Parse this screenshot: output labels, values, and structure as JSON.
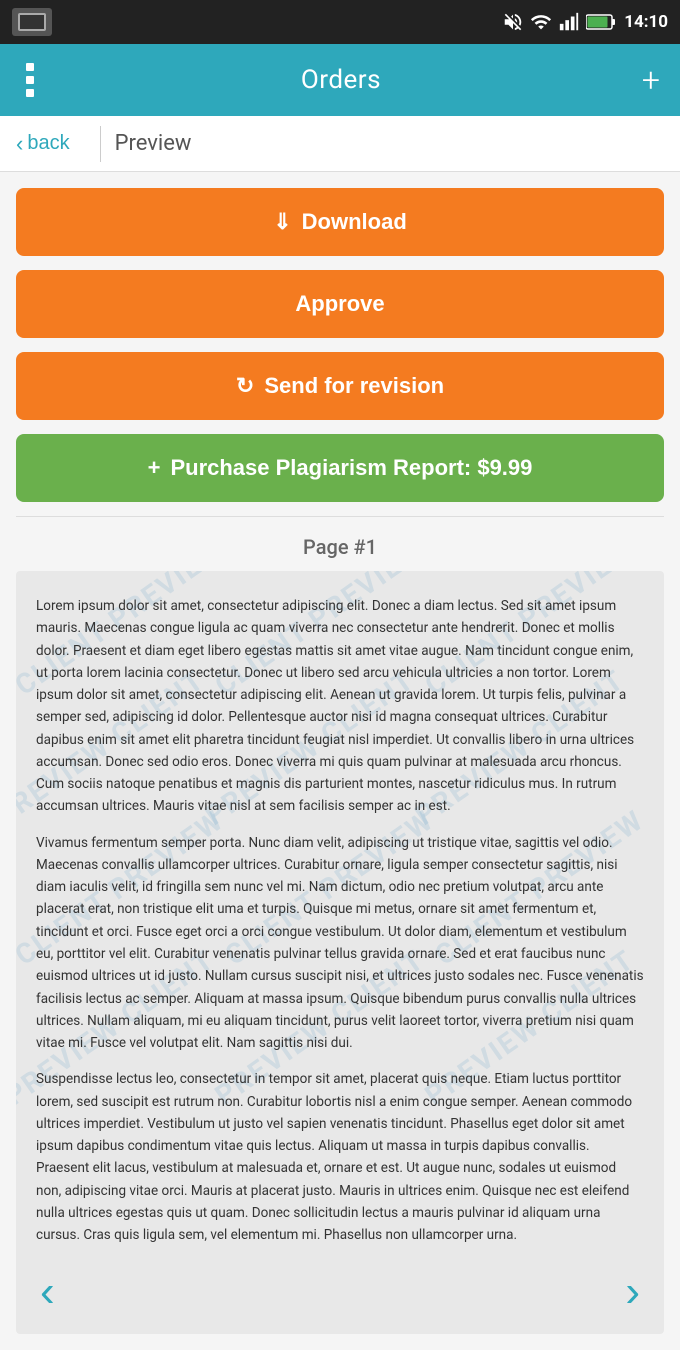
{
  "statusBar": {
    "time": "14:10"
  },
  "appBar": {
    "title": "Orders",
    "addIcon": "+"
  },
  "nav": {
    "backLabel": "back",
    "pageTitle": "Preview"
  },
  "buttons": {
    "download": "Download",
    "approve": "Approve",
    "sendRevision": "Send for revision",
    "plagiarism": "Purchase Plagiarism Report: $9.99"
  },
  "pageLabel": "Page #1",
  "docParagraphs": [
    "Lorem ipsum dolor sit amet, consectetur adipiscing elit. Donec a diam lectus. Sed sit amet ipsum mauris. Maecenas congue ligula ac quam viverra nec consectetur ante hendrerit. Donec et mollis dolor. Praesent et diam eget libero egestas mattis sit amet vitae augue. Nam tincidunt congue enim, ut porta lorem lacinia consectetur. Donec ut libero sed arcu vehicula ultricies a non tortor. Lorem ipsum dolor sit amet, consectetur adipiscing elit. Aenean ut gravida lorem. Ut turpis felis, pulvinar a semper sed, adipiscing id dolor. Pellentesque auctor nisi id magna consequat ultrices. Curabitur dapibus enim sit amet elit pharetra tincidunt feugiat nisl imperdiet. Ut convallis libero in urna ultrices accumsan. Donec sed odio eros. Donec viverra mi quis quam pulvinar at malesuada arcu rhoncus. Cum sociis natoque penatibus et magnis dis parturient montes, nascetur ridiculus mus. In rutrum accumsan ultrices. Mauris vitae nisl at sem facilisis semper ac in est.",
    "Vivamus fermentum semper porta. Nunc diam velit, adipiscing ut tristique vitae, sagittis vel odio. Maecenas convallis ullamcorper ultrices. Curabitur ornare, ligula semper consectetur sagittis, nisi diam iaculis velit, id fringilla sem nunc vel mi. Nam dictum, odio nec pretium volutpat, arcu ante placerat erat, non tristique elit uma et turpis. Quisque mi metus, ornare sit amet fermentum et, tincidunt et orci. Fusce eget orci a orci congue vestibulum. Ut dolor diam, elementum et vestibulum eu, porttitor vel elit. Curabitur venenatis pulvinar tellus gravida ornare. Sed et erat faucibus nunc euismod ultrices ut id justo. Nullam cursus suscipit nisi, et ultrices justo sodales nec. Fusce venenatis facilisis lectus ac semper. Aliquam at massa ipsum. Quisque bibendum purus convallis nulla ultrices ultrices. Nullam aliquam, mi eu aliquam tincidunt, purus velit laoreet tortor, viverra pretium nisi quam vitae mi. Fusce vel volutpat elit. Nam sagittis nisi dui.",
    "Suspendisse lectus leo, consectetur in tempor sit amet, placerat quis neque. Etiam luctus porttitor lorem, sed suscipit est rutrum non. Curabitur lobortis nisl a enim congue semper. Aenean commodo ultrices imperdiet. Vestibulum ut justo vel sapien venenatis tincidunt. Phasellus eget dolor sit amet ipsum dapibus condimentum vitae quis lectus. Aliquam ut massa in turpis dapibus convallis. Praesent elit lacus, vestibulum at malesuada et, ornare et est. Ut augue nunc, sodales ut euismod non, adipiscing vitae orci. Mauris at placerat justo. Mauris in ultrices enim. Quisque nec est eleifend nulla ultrices egestas quis ut quam. Donec sollicitudin lectus a mauris pulvinar id aliquam urna cursus. Cras quis ligula sem, vel elementum mi. Phasellus non ullamcorper urna."
  ]
}
